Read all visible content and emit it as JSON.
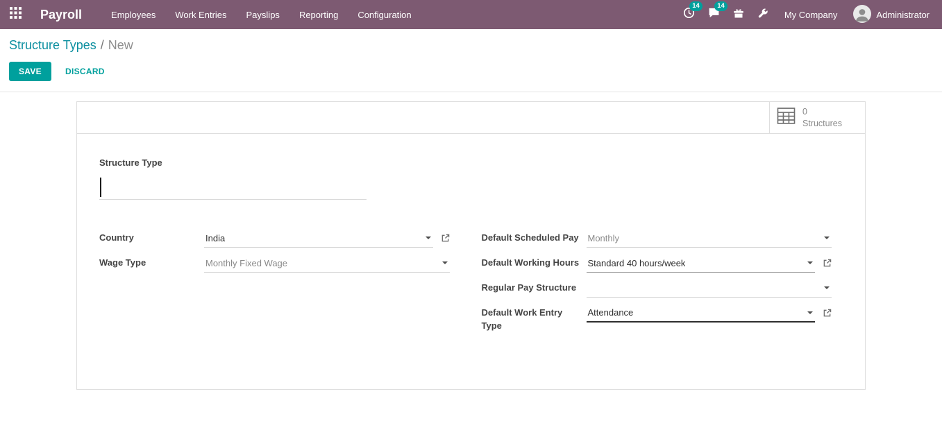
{
  "nav": {
    "brand": "Payroll",
    "items": [
      "Employees",
      "Work Entries",
      "Payslips",
      "Reporting",
      "Configuration"
    ],
    "right": {
      "activity_count": "14",
      "message_count": "14",
      "company": "My Company",
      "user": "Administrator"
    }
  },
  "breadcrumb": {
    "parent": "Structure Types",
    "separator": "/",
    "current": "New"
  },
  "actions": {
    "save": "SAVE",
    "discard": "DISCARD"
  },
  "stat_button": {
    "value": "0",
    "label": "Structures"
  },
  "form": {
    "structure_type_label": "Structure Type",
    "structure_type_value": "",
    "left": [
      {
        "label": "Country",
        "value": "India"
      },
      {
        "label": "Wage Type",
        "value": "Monthly Fixed Wage"
      }
    ],
    "right": [
      {
        "label": "Default Scheduled Pay",
        "value": "Monthly"
      },
      {
        "label": "Default Working Hours",
        "value": "Standard 40 hours/week"
      },
      {
        "label": "Regular Pay Structure",
        "value": ""
      },
      {
        "label": "Default Work Entry Type",
        "value": "Attendance"
      }
    ]
  },
  "colors": {
    "topbar": "#7d5a72",
    "accent": "#00a09d"
  }
}
